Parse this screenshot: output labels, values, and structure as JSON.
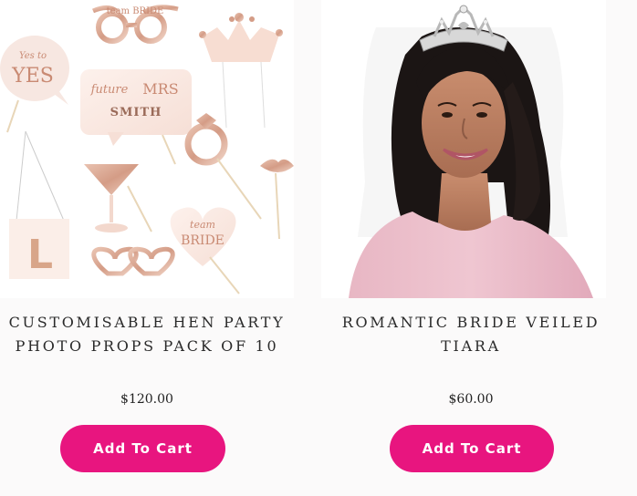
{
  "colors": {
    "button_bg": "#e8157f",
    "page_bg": "#fbfafa"
  },
  "products": [
    {
      "title": "CUSTOMISABLE HEN PARTY PHOTO PROPS PACK OF 10",
      "price": "$120.00",
      "button_label": "Add To Cart",
      "image_text": {
        "glasses": "team BRIDE",
        "speech_yes_script": "Yes to",
        "speech_yes": "YES",
        "mrs_script": "future",
        "mrs": "MRS",
        "smith": "SMITH",
        "l_plate": "L",
        "heart_script": "team",
        "heart": "BRIDE"
      }
    },
    {
      "title": "ROMANTIC BRIDE VEILED TIARA",
      "price": "$60.00",
      "button_label": "Add To Cart"
    }
  ]
}
